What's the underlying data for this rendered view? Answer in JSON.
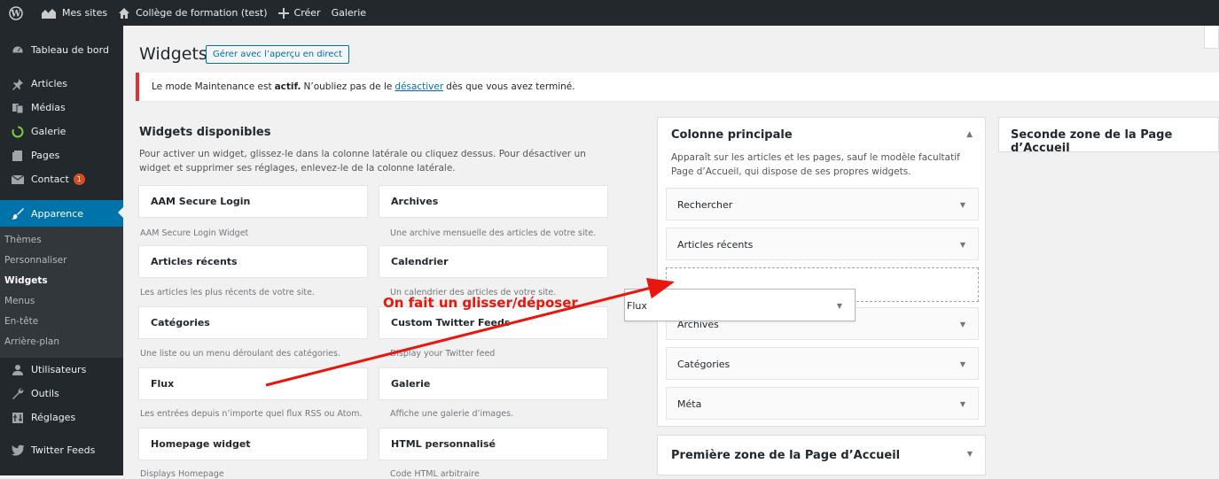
{
  "admin_bar": {
    "my_sites": "Mes sites",
    "site_name": "Collège de formation (test)",
    "create": "Créer",
    "gallery": "Galerie"
  },
  "sidebar": {
    "items": [
      {
        "label": "Tableau de bord",
        "icon": "dashboard-icon"
      },
      {
        "label": "Articles",
        "icon": "pin-icon"
      },
      {
        "label": "Médias",
        "icon": "media-icon"
      },
      {
        "label": "Galerie",
        "icon": "gallery-icon"
      },
      {
        "label": "Pages",
        "icon": "pages-icon"
      },
      {
        "label": "Contact",
        "icon": "mail-icon",
        "badge": "1"
      },
      {
        "label": "Apparence",
        "icon": "appearance-icon"
      }
    ],
    "submenu": [
      "Thèmes",
      "Personnaliser",
      "Widgets",
      "Menus",
      "En-tête",
      "Arrière-plan"
    ],
    "items_after": [
      {
        "label": "Utilisateurs",
        "icon": "users-icon"
      },
      {
        "label": "Outils",
        "icon": "tools-icon"
      },
      {
        "label": "Réglages",
        "icon": "settings-icon"
      },
      {
        "label": "Twitter Feeds",
        "icon": "twitter-icon"
      }
    ],
    "active_color": "#0073aa"
  },
  "header": {
    "title": "Widgets",
    "live_preview": "Gérer avec l’aperçu en direct"
  },
  "notice": {
    "text_before": "Le mode Maintenance est",
    "bold": "actif.",
    "text_mid": "N’oubliez pas de le",
    "link": "désactiver",
    "text_after": "dès que vous avez terminé."
  },
  "available": {
    "title": "Widgets disponibles",
    "description": "Pour activer un widget, glissez-le dans la colonne latérale ou cliquez dessus. Pour désactiver un widget et supprimer ses réglages, enlevez-le de la colonne latérale.",
    "widgets": [
      {
        "name": "AAM Secure Login",
        "desc": "AAM Secure Login Widget"
      },
      {
        "name": "Archives",
        "desc": "Une archive mensuelle des articles de votre site."
      },
      {
        "name": "Articles récents",
        "desc": "Les articles les plus récents de votre site."
      },
      {
        "name": "Calendrier",
        "desc": "Un calendrier des articles de votre site."
      },
      {
        "name": "Catégories",
        "desc": "Une liste ou un menu déroulant des catégories."
      },
      {
        "name": "Custom Twitter Feeds",
        "desc": "Display your Twitter feed"
      },
      {
        "name": "Flux",
        "desc": "Les entrées depuis n’importe quel flux RSS ou Atom."
      },
      {
        "name": "Galerie",
        "desc": "Affiche une galerie d’images."
      },
      {
        "name": "Homepage widget",
        "desc": "Displays Homepage"
      },
      {
        "name": "HTML personnalisé",
        "desc": "Code HTML arbitraire"
      }
    ]
  },
  "main_sidebar": {
    "title": "Colonne principale",
    "description": "Apparaît sur les articles et les pages, sauf le modèle facultatif Page d’Accueil, qui dispose de ses propres widgets.",
    "widgets": [
      "Rechercher",
      "Articles récents",
      "Archives",
      "Catégories",
      "Méta"
    ]
  },
  "dragging_widget": "Flux",
  "annotation": "On fait un glisser/déposer",
  "annotation_color": "#e8160c",
  "home_zone_1": "Première zone de la Page d’Accueil",
  "home_zone_2": "Seconde zone de la Page d’Accueil"
}
